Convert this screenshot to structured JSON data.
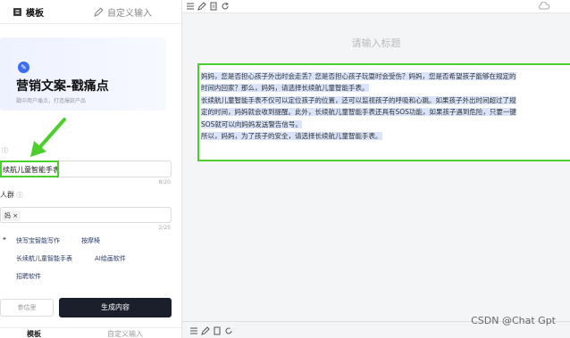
{
  "left_panel": {
    "tabs": {
      "template": "模板",
      "custom": "自定义输入"
    },
    "card": {
      "title": "营销文案-戳痛点",
      "subtitle": "戳中用户痛点，打造爆款产品"
    },
    "field1": {
      "value": "续航儿童智能手表",
      "count": "8/20"
    },
    "field2": {
      "label": "人群",
      "tag": "妈",
      "count": "2/25"
    },
    "chips": [
      "快写宝智能写作",
      "按摩椅",
      "长续航儿童智能手表",
      "AI绘画软件",
      "招聘软件"
    ],
    "buttons": {
      "secondary": "参估里",
      "primary": "生成内容"
    },
    "bottom_tabs": {
      "template": "模板",
      "custom": "自定义输入"
    }
  },
  "right_panel": {
    "placeholder_title": "请输入标题",
    "content_lines": [
      "妈妈，您是否担心孩子外出时会走丢？您是否担心孩子玩耍时会受伤？妈妈，您是否希望孩子能够在规定的",
      "时间内回家？那么，妈妈，请选择长续航儿童智能手表。",
      "长续航儿童智能手表不仅可以定位孩子的位置，还可以监视孩子的呼吸和心跳。如果孩子外出时间超过了规",
      "定的时间，妈妈就会收到提醒。此外，长续航儿童智能手表还具有SOS功能，如果孩子遇到危险，只要一键",
      "SOS就可以向妈妈发送警告信号。",
      "所以，妈妈，为了孩子的安全，请选择长续航儿童智能手表。"
    ],
    "watermark": "CSDN @Chat Gpt"
  },
  "colors": {
    "highlight_green": "#4ccf2c",
    "selection_blue": "#d9e4fb",
    "primary_button": "#1b1f2b"
  }
}
